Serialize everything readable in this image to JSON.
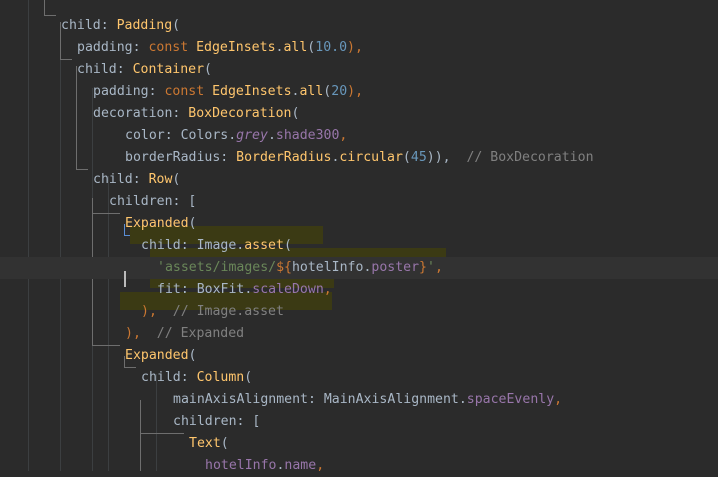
{
  "editor": {
    "lines": [
      {
        "text": ""
      },
      [
        {
          "t": "child: ",
          "c": "c-default"
        },
        {
          "t": "Padding",
          "c": "c-class"
        },
        {
          "t": "(",
          "c": "c-default"
        }
      ],
      [
        {
          "t": "padding: ",
          "c": "c-default"
        },
        {
          "t": "const ",
          "c": "c-keyword"
        },
        {
          "t": "EdgeInsets",
          "c": "c-class"
        },
        {
          "t": ".",
          "c": "c-default"
        },
        {
          "t": "all",
          "c": "c-class"
        },
        {
          "t": "(",
          "c": "c-default"
        },
        {
          "t": "10.0",
          "c": "c-number"
        },
        {
          "t": "),",
          "c": "c-keyword"
        }
      ],
      [
        {
          "t": "child: ",
          "c": "c-default"
        },
        {
          "t": "Container",
          "c": "c-class"
        },
        {
          "t": "(",
          "c": "c-default"
        }
      ],
      [
        {
          "t": "padding: ",
          "c": "c-default"
        },
        {
          "t": "const ",
          "c": "c-keyword"
        },
        {
          "t": "EdgeInsets",
          "c": "c-class"
        },
        {
          "t": ".",
          "c": "c-default"
        },
        {
          "t": "all",
          "c": "c-class"
        },
        {
          "t": "(",
          "c": "c-default"
        },
        {
          "t": "20",
          "c": "c-number"
        },
        {
          "t": "),",
          "c": "c-keyword"
        }
      ],
      [
        {
          "t": "decoration: ",
          "c": "c-default"
        },
        {
          "t": "BoxDecoration",
          "c": "c-class"
        },
        {
          "t": "(",
          "c": "c-default"
        }
      ],
      [
        {
          "t": "color: ",
          "c": "c-default"
        },
        {
          "t": "Colors",
          "c": "c-type"
        },
        {
          "t": ".",
          "c": "c-default"
        },
        {
          "t": "grey",
          "c": "c-italic"
        },
        {
          "t": ".",
          "c": "c-default"
        },
        {
          "t": "shade300",
          "c": "c-field"
        },
        {
          "t": ",",
          "c": "c-keyword"
        }
      ],
      [
        {
          "t": "borderRadius: ",
          "c": "c-default"
        },
        {
          "t": "BorderRadius",
          "c": "c-class"
        },
        {
          "t": ".",
          "c": "c-default"
        },
        {
          "t": "circular",
          "c": "c-class"
        },
        {
          "t": "(",
          "c": "c-default"
        },
        {
          "t": "45",
          "c": "c-number"
        },
        {
          "t": ")),",
          "c": "c-default"
        },
        {
          "t": "  // BoxDecoration",
          "c": "c-comment"
        }
      ],
      [
        {
          "t": "child: ",
          "c": "c-default"
        },
        {
          "t": "Row",
          "c": "c-class"
        },
        {
          "t": "(",
          "c": "c-default"
        }
      ],
      [
        {
          "t": "children: [",
          "c": "c-default"
        }
      ],
      [
        {
          "t": "Expanded",
          "c": "c-class"
        },
        {
          "t": "(",
          "c": "c-default"
        }
      ],
      [
        {
          "t": "child: ",
          "c": "c-default"
        },
        {
          "t": "Image",
          "c": "c-type"
        },
        {
          "t": ".",
          "c": "c-default"
        },
        {
          "t": "asset",
          "c": "c-class"
        },
        {
          "t": "(",
          "c": "c-default"
        }
      ],
      [
        {
          "t": "'assets/images/",
          "c": "c-string"
        },
        {
          "t": "${",
          "c": "c-keyword"
        },
        {
          "t": "hotelInfo",
          "c": "c-default"
        },
        {
          "t": ".",
          "c": "c-default"
        },
        {
          "t": "poster",
          "c": "c-field"
        },
        {
          "t": "}",
          "c": "c-keyword"
        },
        {
          "t": "'",
          "c": "c-string"
        },
        {
          "t": ",",
          "c": "c-keyword"
        }
      ],
      [
        {
          "t": "fit: ",
          "c": "c-default"
        },
        {
          "t": "BoxFit",
          "c": "c-type"
        },
        {
          "t": ".",
          "c": "c-default"
        },
        {
          "t": "scaleDown",
          "c": "c-field"
        },
        {
          "t": ",",
          "c": "c-keyword"
        }
      ],
      [
        {
          "t": "),",
          "c": "c-keyword"
        },
        {
          "t": "  // Image.asset",
          "c": "c-comment"
        }
      ],
      [
        {
          "t": "),",
          "c": "c-keyword"
        },
        {
          "t": "  // Expanded",
          "c": "c-comment"
        }
      ],
      [
        {
          "t": "Expanded",
          "c": "c-class"
        },
        {
          "t": "(",
          "c": "c-default"
        }
      ],
      [
        {
          "t": "child: ",
          "c": "c-default"
        },
        {
          "t": "Column",
          "c": "c-class"
        },
        {
          "t": "(",
          "c": "c-default"
        }
      ],
      [
        {
          "t": "mainAxisAlignment: ",
          "c": "c-default"
        },
        {
          "t": "MainAxisAlignment",
          "c": "c-type"
        },
        {
          "t": ".",
          "c": "c-default"
        },
        {
          "t": "spaceEvenly",
          "c": "c-field"
        },
        {
          "t": ",",
          "c": "c-keyword"
        }
      ],
      [
        {
          "t": "children: [",
          "c": "c-default"
        }
      ],
      [
        {
          "t": "Text",
          "c": "c-class"
        },
        {
          "t": "(",
          "c": "c-default"
        }
      ],
      [
        {
          "t": "hotelInfo",
          "c": "c-field"
        },
        {
          "t": ".",
          "c": "c-default"
        },
        {
          "t": "name",
          "c": "c-field"
        },
        {
          "t": ",",
          "c": "c-keyword"
        }
      ]
    ]
  }
}
